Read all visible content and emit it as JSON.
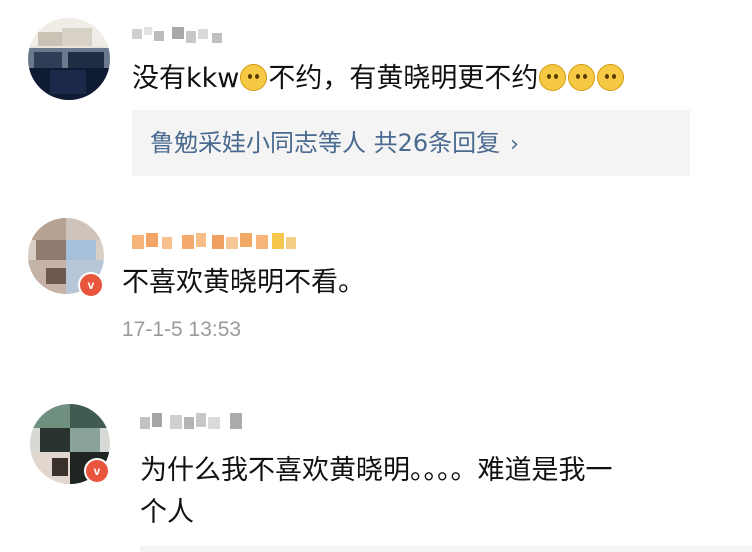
{
  "comments": [
    {
      "text_main": "没有kkw",
      "text_mid": "不约，有黄晓明更不约",
      "emoji_icons": [
        "worried-face-icon",
        "smiling-face-icon",
        "smiling-face-icon",
        "smiling-face-icon"
      ],
      "replies": {
        "label": "鲁勉采娃小同志等人 共26条回复",
        "chevron": "›"
      }
    },
    {
      "text": "不喜欢黄晓明不看。",
      "timestamp": "17-1-5 13:53"
    },
    {
      "text_line1": "为什么我不喜欢黄晓明。。。。难道是我一",
      "text_line2": "个人"
    }
  ],
  "colors": {
    "reply_link": "#4a6a8f",
    "reply_bg": "#f4f4f4",
    "timestamp": "#9a9a9a",
    "badge": "#ffb400"
  }
}
